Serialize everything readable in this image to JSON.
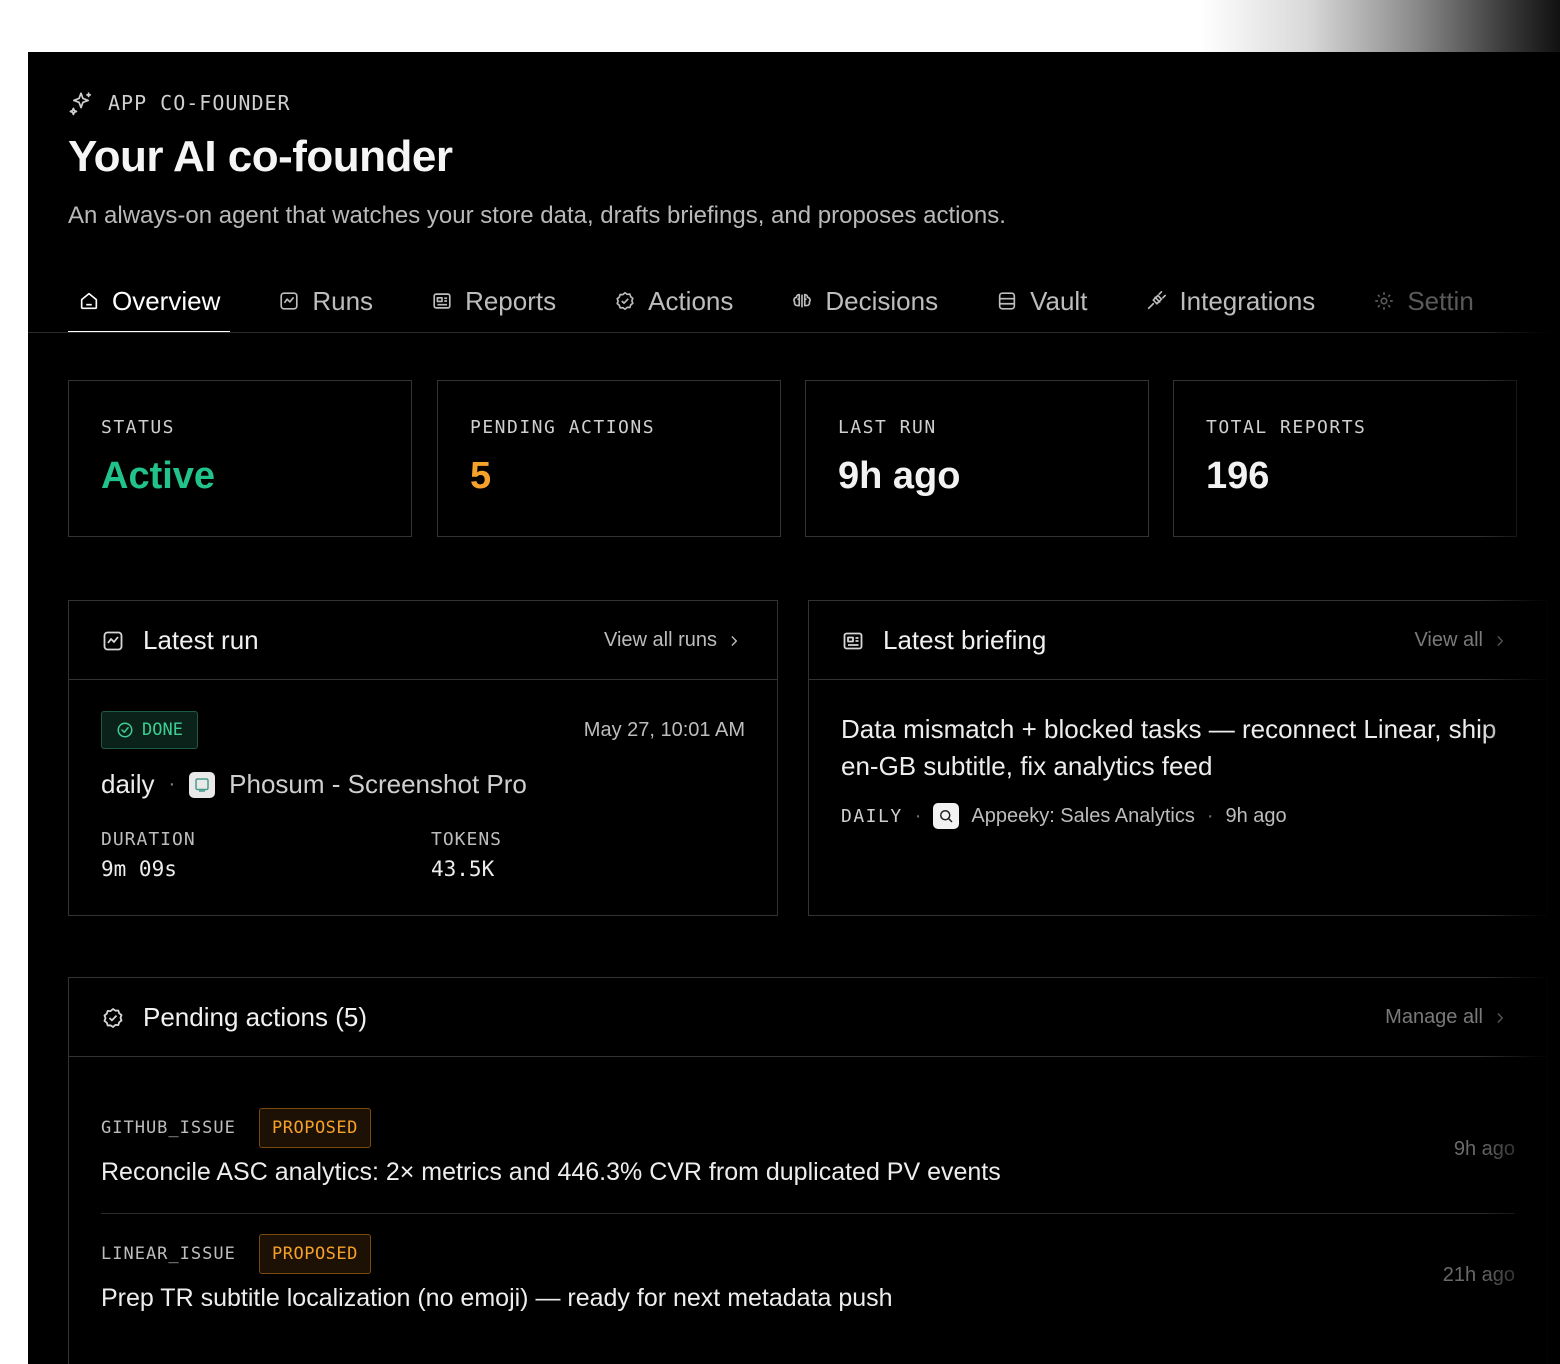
{
  "header": {
    "eyebrow": "APP CO-FOUNDER",
    "title": "Your AI co-founder",
    "subtitle": "An always-on agent that watches your store data, drafts briefings, and proposes actions."
  },
  "tabs": [
    {
      "label": "Overview",
      "icon": "home-icon",
      "active": true
    },
    {
      "label": "Runs",
      "icon": "activity-icon"
    },
    {
      "label": "Reports",
      "icon": "newspaper-icon"
    },
    {
      "label": "Actions",
      "icon": "badge-check-icon"
    },
    {
      "label": "Decisions",
      "icon": "brain-icon"
    },
    {
      "label": "Vault",
      "icon": "database-icon"
    },
    {
      "label": "Integrations",
      "icon": "plug-icon"
    },
    {
      "label": "Settin",
      "icon": "gear-icon"
    }
  ],
  "stats": [
    {
      "label": "STATUS",
      "value": "Active",
      "color": "#22c38a"
    },
    {
      "label": "PENDING ACTIONS",
      "value": "5",
      "color": "#f5a12a"
    },
    {
      "label": "LAST RUN",
      "value": "9h ago",
      "color": "#f2f2f2"
    },
    {
      "label": "TOTAL REPORTS",
      "value": "196",
      "color": "#f2f2f2"
    }
  ],
  "latest_run": {
    "title": "Latest run",
    "link": "View all runs",
    "status": "DONE",
    "date": "May 27, 10:01 AM",
    "kind": "daily",
    "separator": "·",
    "app": "Phosum - Screenshot Pro",
    "duration_label": "DURATION",
    "duration": "9m 09s",
    "tokens_label": "TOKENS",
    "tokens": "43.5K"
  },
  "latest_briefing": {
    "title": "Latest briefing",
    "link": "View all",
    "headline": "Data mismatch + blocked tasks — reconnect Linear, ship en-GB subtitle, fix analytics feed",
    "tag": "DAILY",
    "separator": "·",
    "app": "Appeeky: Sales Analytics",
    "time": "9h ago"
  },
  "pending_actions": {
    "title": "Pending actions (5)",
    "link": "Manage all",
    "items": [
      {
        "type": "GITHUB_ISSUE",
        "status": "PROPOSED",
        "text": "Reconcile ASC analytics: 2× metrics and 446.3% CVR from duplicated PV events",
        "time": "9h ago"
      },
      {
        "type": "LINEAR_ISSUE",
        "status": "PROPOSED",
        "text": "Prep TR subtitle localization (no emoji) — ready for next metadata push",
        "time": "21h ago"
      }
    ]
  }
}
